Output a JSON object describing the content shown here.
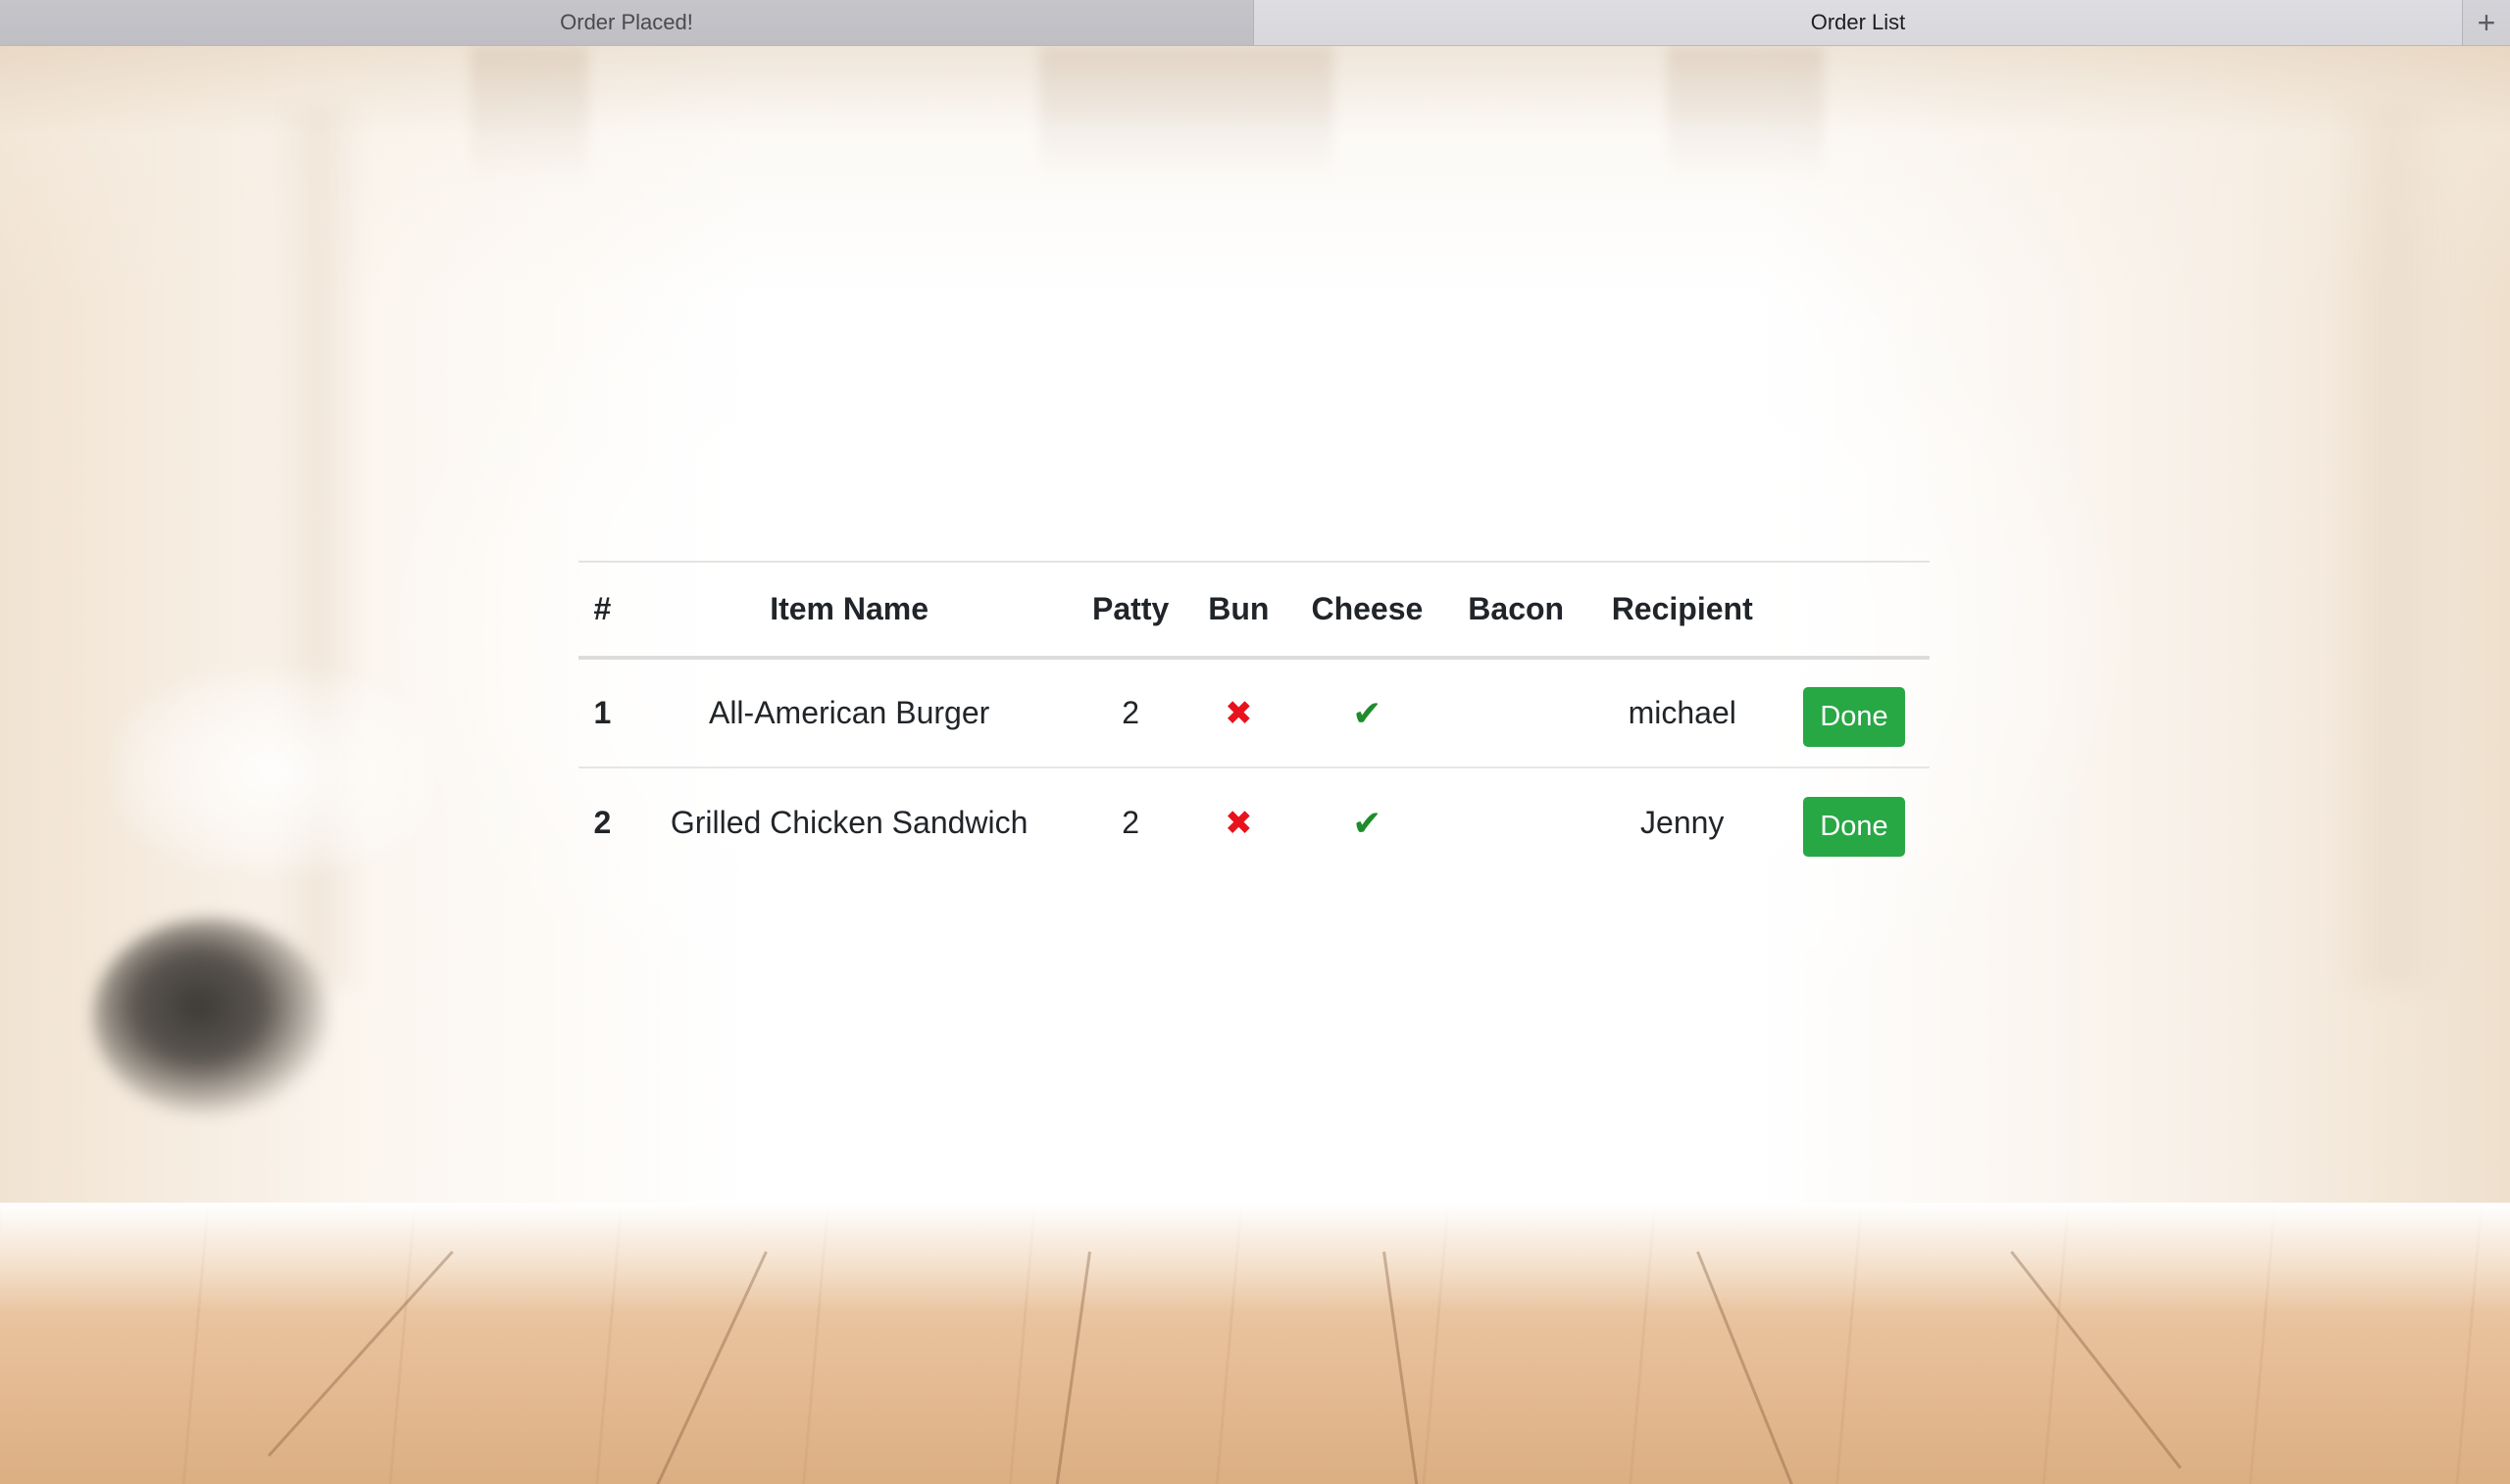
{
  "tabs": [
    {
      "label": "Order Placed!",
      "active": false
    },
    {
      "label": "Order List",
      "active": true
    }
  ],
  "new_tab_icon": "plus-icon",
  "table": {
    "headers": [
      "#",
      "Item Name",
      "Patty",
      "Bun",
      "Cheese",
      "Bacon",
      "Recipient",
      ""
    ],
    "rows": [
      {
        "index": "1",
        "item_name": "All-American Burger",
        "patty": "2",
        "bun": "x-icon",
        "cheese": "check-icon",
        "bacon": "",
        "recipient": "michael",
        "action_label": "Done"
      },
      {
        "index": "2",
        "item_name": "Grilled Chicken Sandwich",
        "patty": "2",
        "bun": "x-icon",
        "cheese": "check-icon",
        "bacon": "",
        "recipient": "Jenny",
        "action_label": "Done"
      }
    ]
  },
  "colors": {
    "done_button": "#28a745",
    "x_icon": "#e8121d",
    "check_icon": "#1e8c2c"
  }
}
